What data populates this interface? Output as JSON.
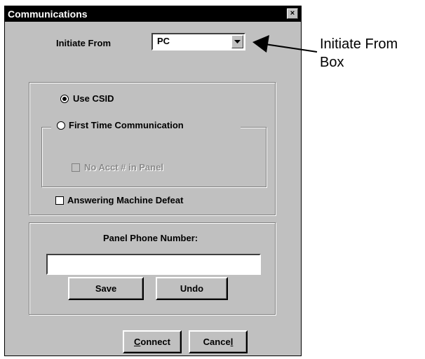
{
  "window": {
    "title": "Communications",
    "close_glyph": "×"
  },
  "initiate": {
    "label": "Initiate From",
    "value": "PC"
  },
  "options": {
    "use_csid": {
      "label": "Use CSID",
      "checked": true
    },
    "first_time": {
      "label": "First Time Communication",
      "checked": false
    },
    "no_acct": {
      "label": "No Acct # in Panel",
      "checked": false,
      "disabled": true
    },
    "answering_machine": {
      "label": "Answering Machine Defeat",
      "checked": false
    }
  },
  "phone": {
    "label": "Panel Phone Number:",
    "value": ""
  },
  "buttons": {
    "save": "Save",
    "undo": "Undo",
    "connect_key": "C",
    "connect_rest": "onnect",
    "cancel_start": "Cance",
    "cancel_key": "l"
  },
  "annotation": {
    "line1": "Initiate From",
    "line2": "Box"
  }
}
